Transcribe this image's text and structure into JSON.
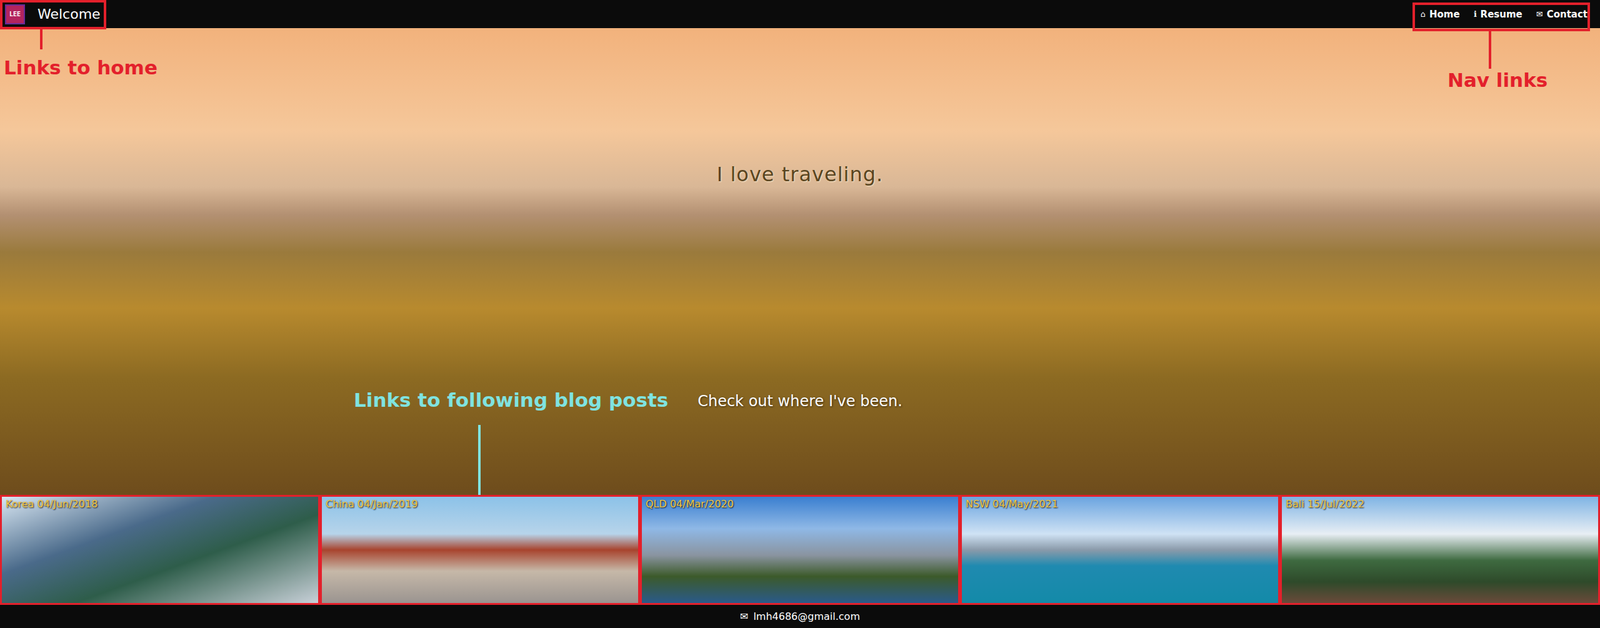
{
  "header": {
    "logo": "LEE",
    "title": "Welcome",
    "nav": [
      {
        "icon": "⌂",
        "label": "Home"
      },
      {
        "icon": "ℹ",
        "label": "Resume"
      },
      {
        "icon": "✉",
        "label": "Contact"
      }
    ]
  },
  "hero": {
    "headline": "I love traveling.",
    "subline": "Check out where I've been."
  },
  "posts": [
    {
      "label": "Korea 04/Jun/2018"
    },
    {
      "label": "China 04/Jan/2019"
    },
    {
      "label": "QLD 04/Mar/2020"
    },
    {
      "label": "NSW 04/May/2021"
    },
    {
      "label": "Bali 15/Jul/2022"
    }
  ],
  "footer": {
    "icon": "✉",
    "email": "lmh4686@gmail.com"
  },
  "annotations": [
    {
      "label": "Links to home",
      "color": "#e3202b"
    },
    {
      "label": "Nav links",
      "color": "#e3202b"
    },
    {
      "label": "Links to following blog posts",
      "color": "#7fe3e0"
    }
  ]
}
